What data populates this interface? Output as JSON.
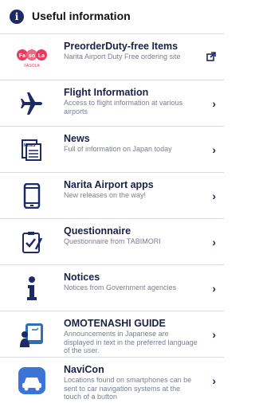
{
  "header": {
    "icon": "info-icon",
    "title": "Useful information"
  },
  "items": [
    {
      "name": "PreorderDuty-free Items",
      "desc": "Narita Airport Duty Free ordering site",
      "icon": "fasola-logo",
      "action_icon": "external-link-icon"
    },
    {
      "name": "Flight Information",
      "desc": "Access to flight information at various airports",
      "icon": "airplane-icon",
      "action_icon": "chevron-right-icon"
    },
    {
      "name": "News",
      "desc": "Full of information on Japan today",
      "icon": "newspaper-icon",
      "action_icon": "chevron-right-icon"
    },
    {
      "name": "Narita Airport apps",
      "desc": "New releases on the way!",
      "icon": "smartphone-icon",
      "action_icon": "chevron-right-icon"
    },
    {
      "name": "Questionnaire",
      "desc": "Questionnaire from TABIMORI",
      "icon": "clipboard-check-icon",
      "action_icon": "chevron-right-icon"
    },
    {
      "name": "Notices",
      "desc": "Notices from Government agencies",
      "icon": "info-icon",
      "action_icon": "chevron-right-icon"
    },
    {
      "name": "OMOTENASHI GUIDE",
      "desc": "Announcements in Japanese are displayed in text in the preferred language of the user.",
      "icon": "omotenashi-guide-icon",
      "action_icon": "chevron-right-icon"
    },
    {
      "name": "NaviCon",
      "desc": "Locations found on smartphones can be sent to car navigation systems at the touch of a button",
      "icon": "navicon-car-icon",
      "action_icon": "chevron-right-icon"
    }
  ],
  "logo": {
    "text": [
      "Fa",
      "so",
      "La"
    ],
    "subtext": "FASOLA"
  },
  "newspaper_label": "NEWS",
  "colors": {
    "navy": "#1d2a66",
    "logo_red": "#e63a5f",
    "navicon_blue": "#3b73d6"
  }
}
